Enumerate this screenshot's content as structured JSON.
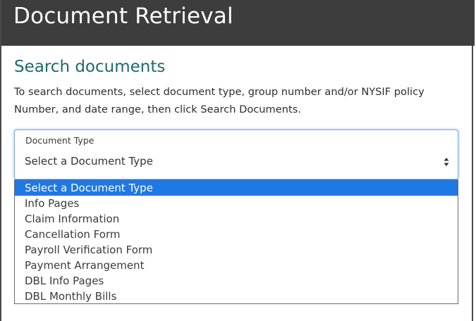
{
  "header": {
    "title": "Document Retrieval"
  },
  "search": {
    "title": "Search documents",
    "instructions": "To search documents, select document type, group number and/or NYSIF policy Number, and date range, then click Search Documents."
  },
  "document_type": {
    "label": "Document Type",
    "selected_value": "Select a Document Type",
    "options": [
      "Select a Document Type",
      "Info Pages",
      "Claim Information",
      "Cancellation Form",
      "Payroll Verification Form",
      "Payment Arrangement",
      "DBL Info Pages",
      "DBL Monthly Bills"
    ],
    "highlighted_option": 0
  },
  "colors": {
    "header_bg": "#3d3d3d",
    "section_title": "#1e6a6a",
    "option_highlight": "#1e78e6",
    "focus_border": "#7fb0e0"
  },
  "icons": {
    "select_arrows": "up-down-chevron-icon"
  }
}
